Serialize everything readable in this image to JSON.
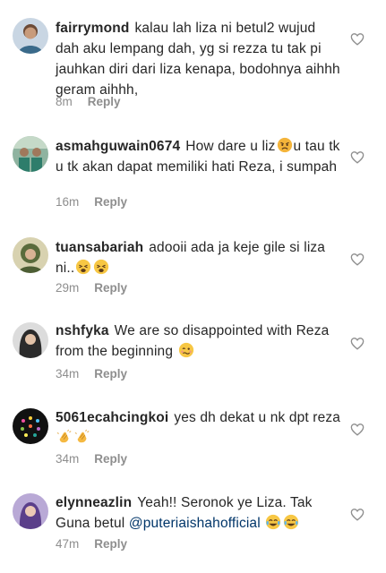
{
  "comments": [
    {
      "username": "fairrymond",
      "text": "kalau lah liza ni betul2 wujud dah aku lempang dah, yg si rezza tu tak pi jauhkan diri dari liza kenapa, bodohnya aihhh geram aihhh,",
      "time": "8m",
      "reply": "Reply"
    },
    {
      "username": "asmahguwain0674",
      "text_before": "How dare u liz",
      "text_after": "u tau tk u tk akan dapat memiliki hati Reza, i sumpah",
      "emoji": "angry-face-emoji",
      "time": "16m",
      "reply": "Reply"
    },
    {
      "username": "tuansabariah",
      "text": "adooii ada ja keje gile si liza ni..",
      "emoji": "weary-face-emoji",
      "time": "29m",
      "reply": "Reply"
    },
    {
      "username": "nshfyka",
      "text": "We are so disappointed with Reza from the beginning",
      "emoji": "woozy-face-emoji",
      "time": "34m",
      "reply": "Reply"
    },
    {
      "username": "5061ecahcingkoi",
      "text": "yes dh dekat u nk dpt reza",
      "emoji": "clapping-hands-emoji",
      "time": "34m",
      "reply": "Reply"
    },
    {
      "username": "elynneazlin",
      "text": "Yeah!! Seronok ye Liza. Tak Guna betul",
      "mention": "@puteriaishahofficial",
      "emoji": "tears-of-joy-emoji",
      "time": "47m",
      "reply": "Reply"
    }
  ],
  "colors": {
    "text": "#262626",
    "meta": "#8e8e8e",
    "mention": "#003569",
    "background": "#ffffff"
  },
  "icons": {
    "like": "heart-outline-icon"
  }
}
